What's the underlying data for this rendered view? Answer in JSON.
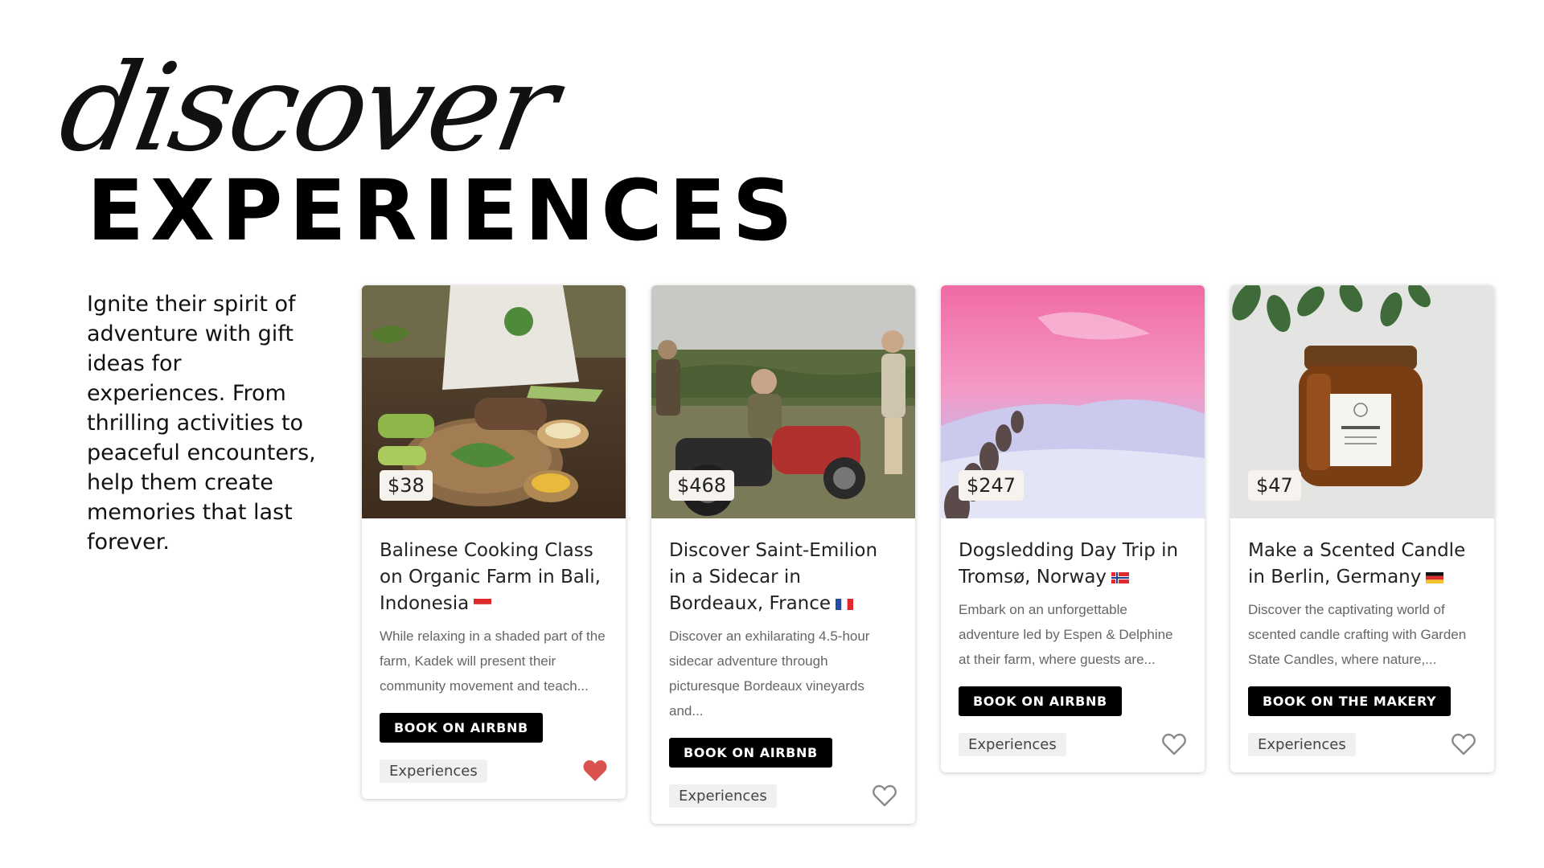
{
  "header": {
    "script_title": "discover",
    "main_title": "EXPERIENCES"
  },
  "intro": {
    "text": "Ignite their spirit of adventure with gift ideas for experiences. From thrilling activities to peaceful encounters, help them create memories that last forever."
  },
  "cards": [
    {
      "price": "$38",
      "title": "Balinese Cooking Class on Organic Farm in Bali, Indonesia",
      "flag": "indonesia-flag-icon",
      "description": "While relaxing in a shaded part of the farm, Kadek will present their community movement and teach...",
      "button": "BOOK ON AIRBNB",
      "tag": "Experiences",
      "favorited": true,
      "image": "cooking-class-photo"
    },
    {
      "price": "$468",
      "title": "Discover Saint-Emilion in a Sidecar in Bordeaux, France",
      "flag": "france-flag-icon",
      "description": "Discover an exhilarating 4.5-hour sidecar adventure through picturesque Bordeaux vineyards and...",
      "button": "BOOK ON AIRBNB",
      "tag": "Experiences",
      "favorited": false,
      "image": "sidecar-vineyard-photo"
    },
    {
      "price": "$247",
      "title": "Dogsledding Day Trip in Tromsø, Norway",
      "flag": "norway-flag-icon",
      "description": "Embark on an unforgettable adventure led by Espen & Delphine at their farm, where guests are...",
      "button": "BOOK ON AIRBNB",
      "tag": "Experiences",
      "favorited": false,
      "image": "dogsled-snow-photo"
    },
    {
      "price": "$47",
      "title": "Make a Scented Candle in Berlin, Germany",
      "flag": "germany-flag-icon",
      "description": "Discover the captivating world of scented candle crafting with Garden State Candles, where nature,...",
      "button": "BOOK ON THE MAKERY",
      "tag": "Experiences",
      "favorited": false,
      "image": "amber-candle-photo"
    }
  ],
  "colors": {
    "heart_filled": "#d9534f",
    "heart_outline": "#8a8a8a",
    "button_bg": "#000000",
    "price_bg": "#f6f3ee"
  }
}
